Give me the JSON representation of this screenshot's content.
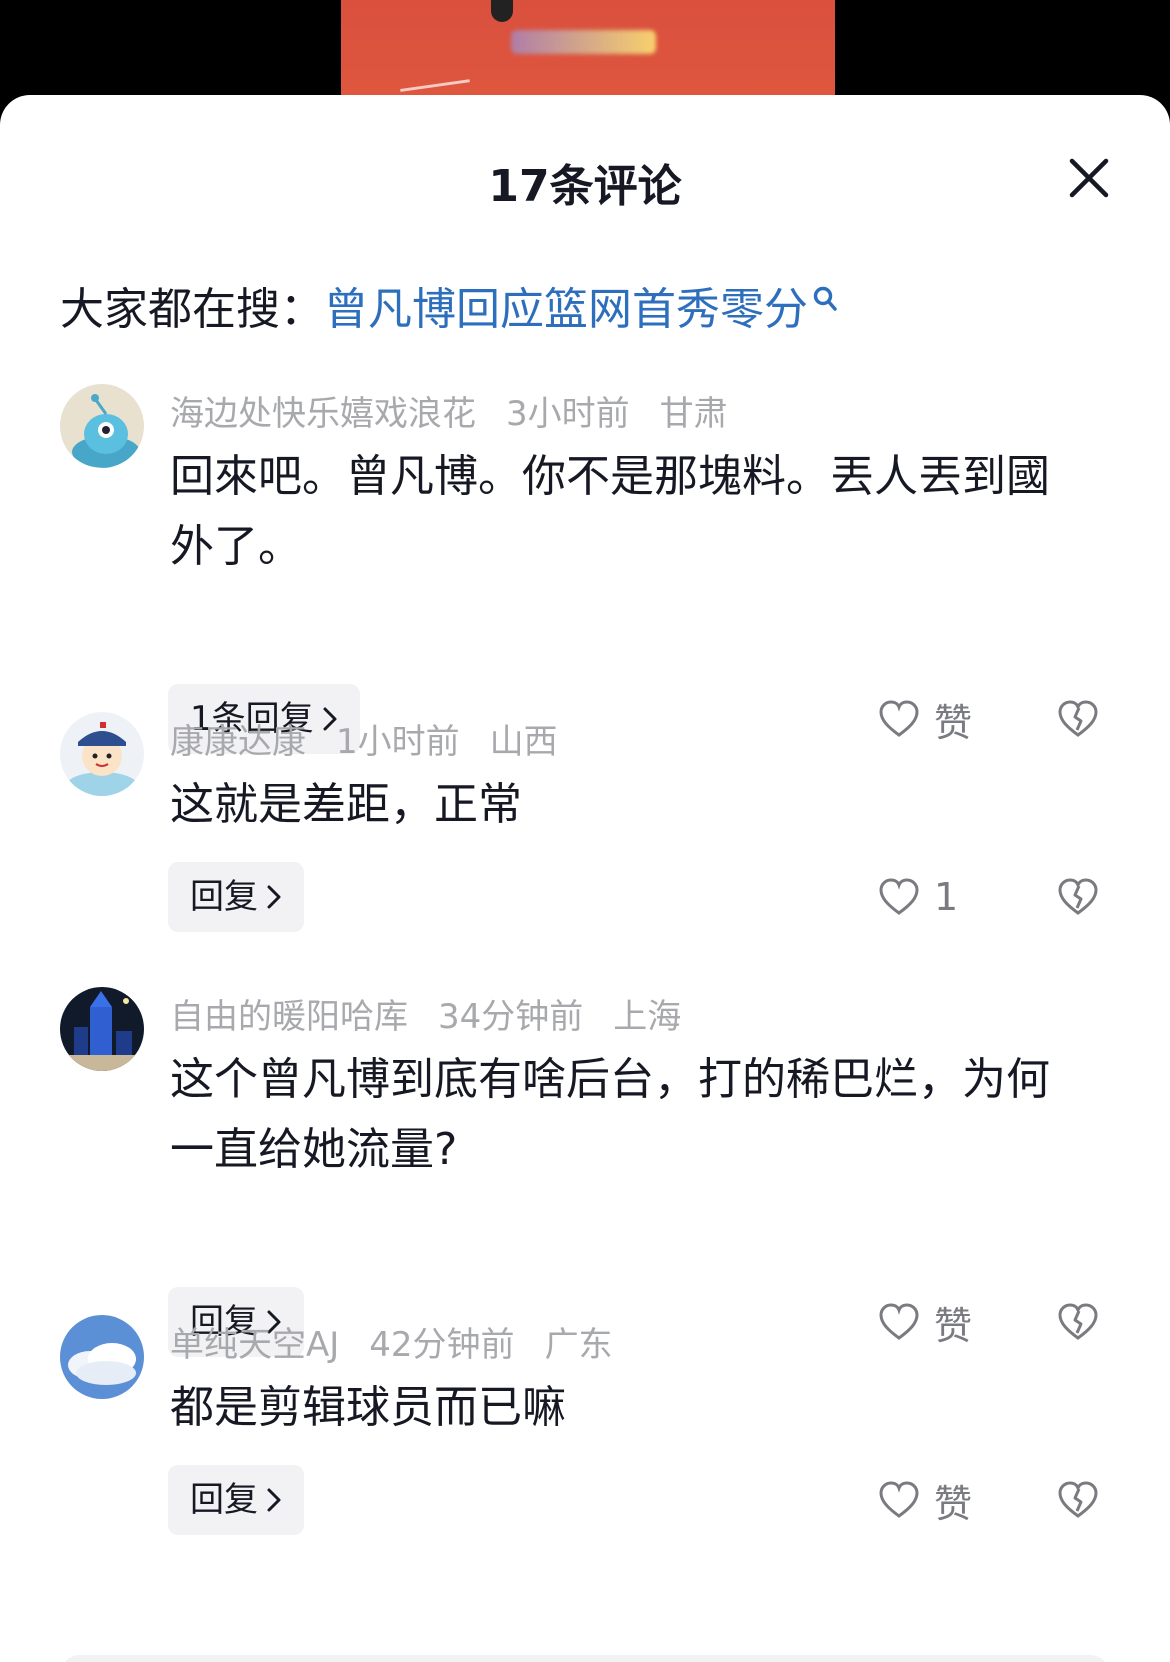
{
  "header": {
    "title": "17条评论"
  },
  "trending": {
    "label": "大家都在搜：",
    "query": "曾凡博回应篮网首秀零分"
  },
  "comments": [
    {
      "username": "海边处快乐嬉戏浪花",
      "time": "3小时前",
      "location": "甘肃",
      "text": "回來吧。曾凡博。你不是那塊料。丟人丟到國外了。",
      "reply_label": "1条回复",
      "like_label": "赞"
    },
    {
      "username": "康康达康",
      "time": "1小时前",
      "location": "山西",
      "text": "这就是差距，正常",
      "reply_label": "回复",
      "like_label": "1"
    },
    {
      "username": "自由的暖阳哈库",
      "time": "34分钟前",
      "location": "上海",
      "text": "这个曾凡博到底有啥后台，打的稀巴烂，为何一直给她流量?",
      "reply_label": "回复",
      "like_label": "赞"
    },
    {
      "username": "单纯天空AJ",
      "time": "42分钟前",
      "location": "广东",
      "text": "都是剪辑球员而已嘛",
      "reply_label": "回复",
      "like_label": "赞"
    }
  ],
  "icons": {
    "close": "close-icon",
    "search": "search-icon",
    "like": "heart-icon",
    "dislike": "broken-heart-icon",
    "chevron": "chevron-right-icon"
  },
  "colors": {
    "link": "#2e6fbd",
    "meta": "#a8a9ad",
    "text": "#161823",
    "reply_bg": "#f2f2f4"
  }
}
